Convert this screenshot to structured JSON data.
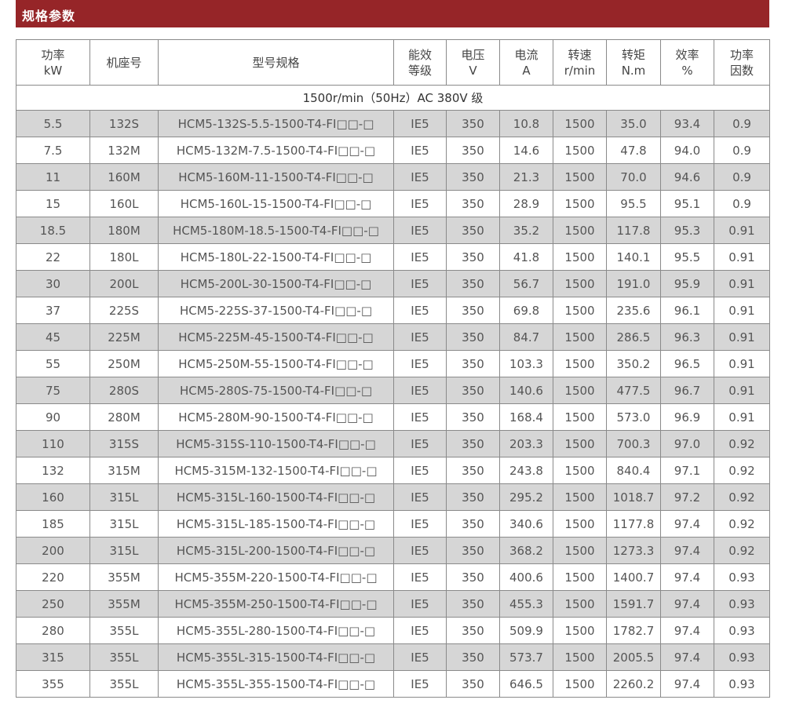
{
  "section_title": "规格参数",
  "headers": [
    [
      "功率",
      "kW"
    ],
    [
      "机座号"
    ],
    [
      "型号规格"
    ],
    [
      "能效",
      "等级"
    ],
    [
      "电压",
      "V"
    ],
    [
      "电流",
      "A"
    ],
    [
      "转速",
      "r/min"
    ],
    [
      "转矩",
      "N.m"
    ],
    [
      "效率",
      "%"
    ],
    [
      "功率",
      "因数"
    ]
  ],
  "group_label": "1500r/min（50Hz）AC 380V 级",
  "rows": [
    [
      "5.5",
      "132S",
      "HCM5-132S-5.5-1500-T4-FI□□-□",
      "IE5",
      "350",
      "10.8",
      "1500",
      "35.0",
      "93.4",
      "0.9"
    ],
    [
      "7.5",
      "132M",
      "HCM5-132M-7.5-1500-T4-FI□□-□",
      "IE5",
      "350",
      "14.6",
      "1500",
      "47.8",
      "94.0",
      "0.9"
    ],
    [
      "11",
      "160M",
      "HCM5-160M-11-1500-T4-FI□□-□",
      "IE5",
      "350",
      "21.3",
      "1500",
      "70.0",
      "94.6",
      "0.9"
    ],
    [
      "15",
      "160L",
      "HCM5-160L-15-1500-T4-FI□□-□",
      "IE5",
      "350",
      "28.9",
      "1500",
      "95.5",
      "95.1",
      "0.9"
    ],
    [
      "18.5",
      "180M",
      "HCM5-180M-18.5-1500-T4-FI□□-□",
      "IE5",
      "350",
      "35.2",
      "1500",
      "117.8",
      "95.3",
      "0.91"
    ],
    [
      "22",
      "180L",
      "HCM5-180L-22-1500-T4-FI□□-□",
      "IE5",
      "350",
      "41.8",
      "1500",
      "140.1",
      "95.5",
      "0.91"
    ],
    [
      "30",
      "200L",
      "HCM5-200L-30-1500-T4-FI□□-□",
      "IE5",
      "350",
      "56.7",
      "1500",
      "191.0",
      "95.9",
      "0.91"
    ],
    [
      "37",
      "225S",
      "HCM5-225S-37-1500-T4-FI□□-□",
      "IE5",
      "350",
      "69.8",
      "1500",
      "235.6",
      "96.1",
      "0.91"
    ],
    [
      "45",
      "225M",
      "HCM5-225M-45-1500-T4-FI□□-□",
      "IE5",
      "350",
      "84.7",
      "1500",
      "286.5",
      "96.3",
      "0.91"
    ],
    [
      "55",
      "250M",
      "HCM5-250M-55-1500-T4-FI□□-□",
      "IE5",
      "350",
      "103.3",
      "1500",
      "350.2",
      "96.5",
      "0.91"
    ],
    [
      "75",
      "280S",
      "HCM5-280S-75-1500-T4-FI□□-□",
      "IE5",
      "350",
      "140.6",
      "1500",
      "477.5",
      "96.7",
      "0.91"
    ],
    [
      "90",
      "280M",
      "HCM5-280M-90-1500-T4-FI□□-□",
      "IE5",
      "350",
      "168.4",
      "1500",
      "573.0",
      "96.9",
      "0.91"
    ],
    [
      "110",
      "315S",
      "HCM5-315S-110-1500-T4-FI□□-□",
      "IE5",
      "350",
      "203.3",
      "1500",
      "700.3",
      "97.0",
      "0.92"
    ],
    [
      "132",
      "315M",
      "HCM5-315M-132-1500-T4-FI□□-□",
      "IE5",
      "350",
      "243.8",
      "1500",
      "840.4",
      "97.1",
      "0.92"
    ],
    [
      "160",
      "315L",
      "HCM5-315L-160-1500-T4-FI□□-□",
      "IE5",
      "350",
      "295.2",
      "1500",
      "1018.7",
      "97.2",
      "0.92"
    ],
    [
      "185",
      "315L",
      "HCM5-315L-185-1500-T4-FI□□-□",
      "IE5",
      "350",
      "340.6",
      "1500",
      "1177.8",
      "97.4",
      "0.92"
    ],
    [
      "200",
      "315L",
      "HCM5-315L-200-1500-T4-FI□□-□",
      "IE5",
      "350",
      "368.2",
      "1500",
      "1273.3",
      "97.4",
      "0.92"
    ],
    [
      "220",
      "355M",
      "HCM5-355M-220-1500-T4-FI□□-□",
      "IE5",
      "350",
      "400.6",
      "1500",
      "1400.7",
      "97.4",
      "0.93"
    ],
    [
      "250",
      "355M",
      "HCM5-355M-250-1500-T4-FI□□-□",
      "IE5",
      "350",
      "455.3",
      "1500",
      "1591.7",
      "97.4",
      "0.93"
    ],
    [
      "280",
      "355L",
      "HCM5-355L-280-1500-T4-FI□□-□",
      "IE5",
      "350",
      "509.9",
      "1500",
      "1782.7",
      "97.4",
      "0.93"
    ],
    [
      "315",
      "355L",
      "HCM5-355L-315-1500-T4-FI□□-□",
      "IE5",
      "350",
      "573.7",
      "1500",
      "2005.5",
      "97.4",
      "0.93"
    ],
    [
      "355",
      "355L",
      "HCM5-355L-355-1500-T4-FI□□-□",
      "IE5",
      "350",
      "646.5",
      "1500",
      "2260.2",
      "97.4",
      "0.93"
    ]
  ],
  "colors": {
    "banner": "#962528",
    "row_alt": "#d6d6d6",
    "border": "#8a8a8a"
  }
}
